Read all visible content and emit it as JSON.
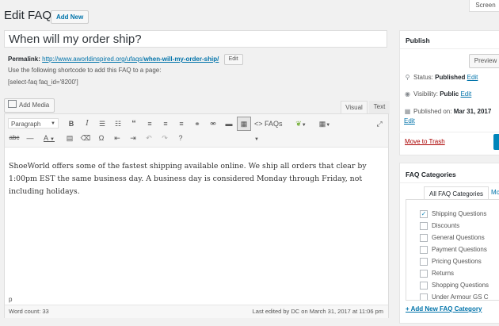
{
  "header": {
    "title": "Edit FAQ",
    "add_new": "Add New",
    "screen_options": "Screen"
  },
  "post": {
    "title": "When will my order ship?",
    "permalink_label": "Permalink:",
    "permalink_base": "http://www.aworldinspired.org/ufaqs/",
    "permalink_slug": "when-will-my-order-ship/",
    "permalink_edit": "Edit",
    "shortcode_note": "Use the following shortcode to add this FAQ to a page:",
    "shortcode": "[select-faq faq_id='8200']"
  },
  "editor": {
    "add_media": "Add Media",
    "tab_visual": "Visual",
    "tab_text": "Text",
    "format_select": "Paragraph",
    "faqs_button": "FAQs",
    "content": "ShoeWorld offers some of the fastest shipping available online. We ship all orders that clear by 1:00pm EST the same business day. A business day is considered Monday through Friday, not including holidays.",
    "path": "p",
    "word_count": "Word count: 33",
    "last_edited": "Last edited by DC on March 31, 2017 at 11:06 pm"
  },
  "publish": {
    "title": "Publish",
    "preview": "Preview",
    "status_label": "Status:",
    "status_value": "Published",
    "visibility_label": "Visibility:",
    "visibility_value": "Public",
    "published_label": "Published on:",
    "published_value": "Mar 31, 2017",
    "edit": "Edit",
    "trash": "Move to Trash"
  },
  "categories": {
    "title": "FAQ Categories",
    "tab_all": "All FAQ Categories",
    "tab_most": "Mo",
    "items": [
      {
        "label": "Shipping Questions",
        "checked": true
      },
      {
        "label": "Discounts",
        "checked": false
      },
      {
        "label": "General Questions",
        "checked": false
      },
      {
        "label": "Payment Questions",
        "checked": false
      },
      {
        "label": "Pricing Questions",
        "checked": false
      },
      {
        "label": "Returns",
        "checked": false
      },
      {
        "label": "Shopping Questions",
        "checked": false
      },
      {
        "label": "Under Armour GS C",
        "checked": false
      }
    ],
    "add_new": "+ Add New FAQ Category"
  },
  "colors": {
    "link": "#0073aa",
    "trash": "#a00000",
    "primary_button": "#0085ba"
  }
}
